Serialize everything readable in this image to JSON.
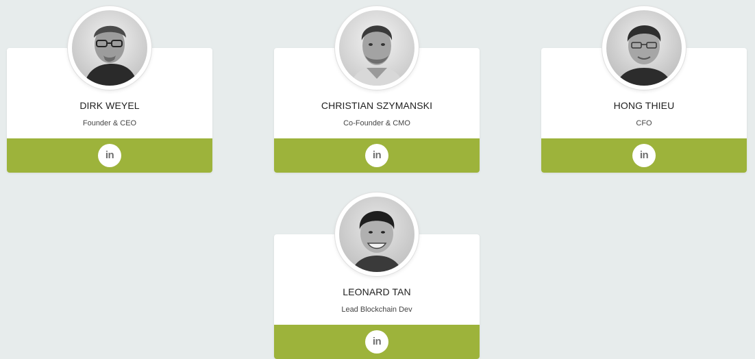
{
  "team": [
    {
      "name": "DIRK WEYEL",
      "role": "Founder & CEO",
      "social": "in"
    },
    {
      "name": "CHRISTIAN SZYMANSKI",
      "role": "Co-Founder & CMO",
      "social": "in"
    },
    {
      "name": "HONG THIEU",
      "role": "CFO",
      "social": "in"
    },
    {
      "name": "LEONARD TAN",
      "role": "Lead Blockchain Dev",
      "social": "in"
    }
  ],
  "colors": {
    "background": "#e7ecec",
    "card": "#ffffff",
    "accent": "#9db33b",
    "icon": "linkedin-icon"
  }
}
